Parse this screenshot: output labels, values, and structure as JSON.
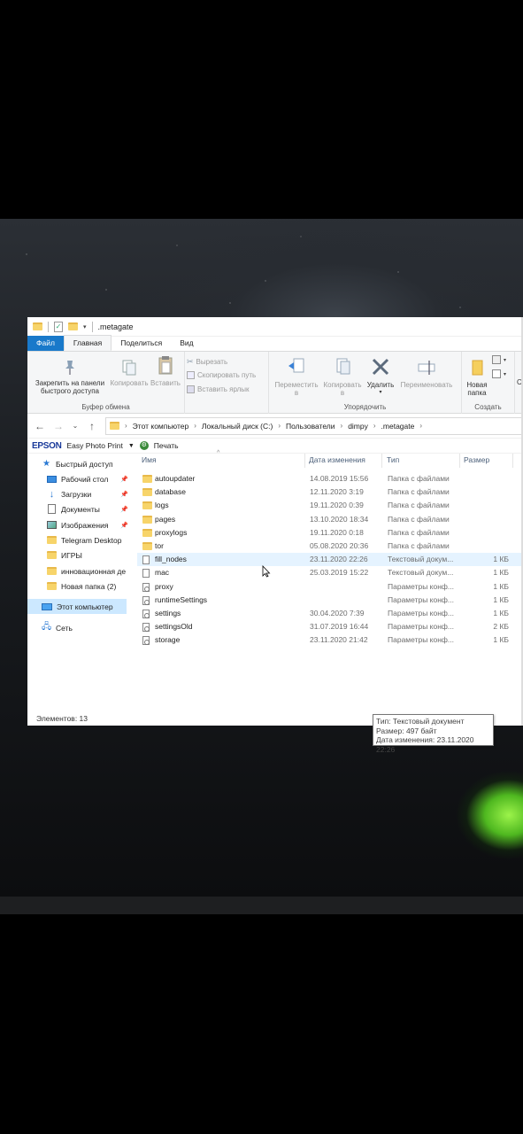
{
  "window": {
    "title": ".metagate"
  },
  "tabs": [
    "Файл",
    "Главная",
    "Поделиться",
    "Вид"
  ],
  "ribbon": {
    "pin_label_1": "Закрепить на панели",
    "pin_label_2": "быстрого доступа",
    "copy": "Копировать",
    "paste": "Вставить",
    "cut": "Вырезать",
    "copy_path": "Скопировать путь",
    "paste_shortcut": "Вставить ярлык",
    "clipboard_group": "Буфер обмена",
    "move_1": "Переместить",
    "move_2": "в",
    "copyto_1": "Копировать",
    "copyto_2": "в",
    "delete": "Удалить",
    "rename": "Переименовать",
    "organize_group": "Упорядочить",
    "newfolder_1": "Новая",
    "newfolder_2": "папка",
    "create_group": "Создать",
    "cut_off_right": "С"
  },
  "address": {
    "crumbs": [
      "Этот компьютер",
      "Локальный диск (C:)",
      "Пользователи",
      "dimpy",
      ".metagate"
    ]
  },
  "epson": {
    "logo": "EPSON",
    "app": "Easy Photo Print",
    "print": "Печать"
  },
  "nav": {
    "items": [
      {
        "label": "Быстрый доступ",
        "icon": "star-icon",
        "pinned": false
      },
      {
        "label": "Рабочий стол",
        "icon": "desktop-icon",
        "pinned": true
      },
      {
        "label": "Загрузки",
        "icon": "download-icon",
        "pinned": true
      },
      {
        "label": "Документы",
        "icon": "document-icon",
        "pinned": true
      },
      {
        "label": "Изображения",
        "icon": "pictures-icon",
        "pinned": true
      },
      {
        "label": "Telegram Desktop",
        "icon": "folder-icon",
        "pinned": false
      },
      {
        "label": "ИГРЫ",
        "icon": "folder-icon",
        "pinned": false
      },
      {
        "label": "инновационная де",
        "icon": "folder-icon",
        "pinned": false
      },
      {
        "label": "Новая папка (2)",
        "icon": "folder-icon",
        "pinned": false
      },
      {
        "label": "Этот компьютер",
        "icon": "computer-icon",
        "pinned": false
      },
      {
        "label": "Сеть",
        "icon": "network-icon",
        "pinned": false
      }
    ]
  },
  "columns": {
    "name": "Имя",
    "date": "Дата изменения",
    "type": "Тип",
    "size": "Размер"
  },
  "files": [
    {
      "name": "autoupdater",
      "date": "14.08.2019 15:56",
      "type": "Папка с файлами",
      "size": "",
      "kind": "folder"
    },
    {
      "name": "database",
      "date": "12.11.2020 3:19",
      "type": "Папка с файлами",
      "size": "",
      "kind": "folder"
    },
    {
      "name": "logs",
      "date": "19.11.2020 0:39",
      "type": "Папка с файлами",
      "size": "",
      "kind": "folder"
    },
    {
      "name": "pages",
      "date": "13.10.2020 18:34",
      "type": "Папка с файлами",
      "size": "",
      "kind": "folder"
    },
    {
      "name": "proxylogs",
      "date": "19.11.2020 0:18",
      "type": "Папка с файлами",
      "size": "",
      "kind": "folder"
    },
    {
      "name": "tor",
      "date": "05.08.2020 20:36",
      "type": "Папка с файлами",
      "size": "",
      "kind": "folder"
    },
    {
      "name": "fill_nodes",
      "date": "23.11.2020 22:26",
      "type": "Текстовый докум...",
      "size": "1 КБ",
      "kind": "text"
    },
    {
      "name": "mac",
      "date": "25.03.2019 15:22",
      "type": "Текстовый докум...",
      "size": "1 КБ",
      "kind": "text"
    },
    {
      "name": "proxy",
      "date": "",
      "type": "Параметры конф...",
      "size": "1 КБ",
      "kind": "config"
    },
    {
      "name": "runtimeSettings",
      "date": "",
      "type": "Параметры конф...",
      "size": "1 КБ",
      "kind": "config"
    },
    {
      "name": "settings",
      "date": "30.04.2020 7:39",
      "type": "Параметры конф...",
      "size": "1 КБ",
      "kind": "config"
    },
    {
      "name": "settingsOld",
      "date": "31.07.2019 16:44",
      "type": "Параметры конф...",
      "size": "2 КБ",
      "kind": "config"
    },
    {
      "name": "storage",
      "date": "23.11.2020 21:42",
      "type": "Параметры конф...",
      "size": "1 КБ",
      "kind": "config"
    }
  ],
  "tooltip": {
    "type": "Тип: Текстовый документ",
    "size": "Размер: 497 байт",
    "date": "Дата изменения: 23.11.2020 22:26"
  },
  "status": {
    "items": "Элементов: 13"
  },
  "colors": {
    "file_tab": "#1979ca",
    "selection": "#cce8ff",
    "hover": "#e5f3ff",
    "folder": "#f7d46a",
    "tent_glow": "#9cf34a"
  }
}
